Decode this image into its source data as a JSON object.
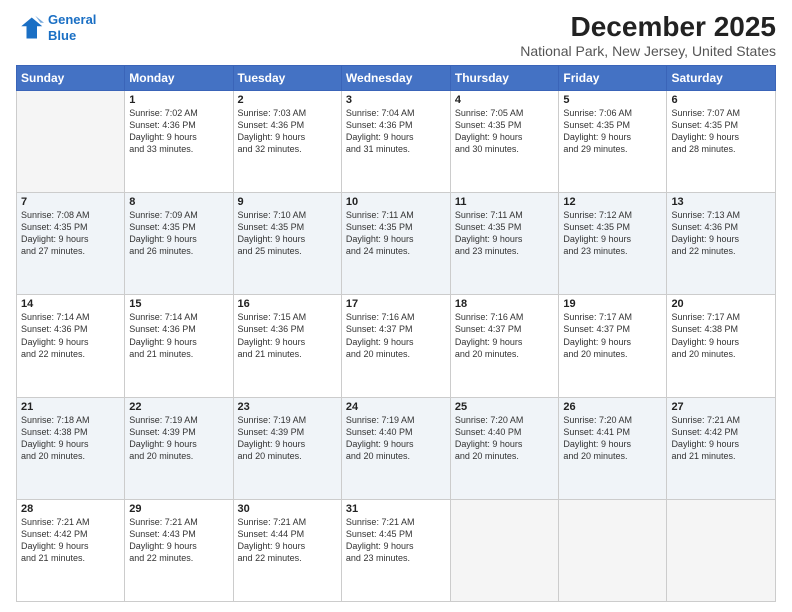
{
  "logo": {
    "line1": "General",
    "line2": "Blue"
  },
  "title": "December 2025",
  "subtitle": "National Park, New Jersey, United States",
  "days_header": [
    "Sunday",
    "Monday",
    "Tuesday",
    "Wednesday",
    "Thursday",
    "Friday",
    "Saturday"
  ],
  "weeks": [
    [
      {
        "num": "",
        "info": ""
      },
      {
        "num": "1",
        "info": "Sunrise: 7:02 AM\nSunset: 4:36 PM\nDaylight: 9 hours\nand 33 minutes."
      },
      {
        "num": "2",
        "info": "Sunrise: 7:03 AM\nSunset: 4:36 PM\nDaylight: 9 hours\nand 32 minutes."
      },
      {
        "num": "3",
        "info": "Sunrise: 7:04 AM\nSunset: 4:36 PM\nDaylight: 9 hours\nand 31 minutes."
      },
      {
        "num": "4",
        "info": "Sunrise: 7:05 AM\nSunset: 4:35 PM\nDaylight: 9 hours\nand 30 minutes."
      },
      {
        "num": "5",
        "info": "Sunrise: 7:06 AM\nSunset: 4:35 PM\nDaylight: 9 hours\nand 29 minutes."
      },
      {
        "num": "6",
        "info": "Sunrise: 7:07 AM\nSunset: 4:35 PM\nDaylight: 9 hours\nand 28 minutes."
      }
    ],
    [
      {
        "num": "7",
        "info": "Sunrise: 7:08 AM\nSunset: 4:35 PM\nDaylight: 9 hours\nand 27 minutes."
      },
      {
        "num": "8",
        "info": "Sunrise: 7:09 AM\nSunset: 4:35 PM\nDaylight: 9 hours\nand 26 minutes."
      },
      {
        "num": "9",
        "info": "Sunrise: 7:10 AM\nSunset: 4:35 PM\nDaylight: 9 hours\nand 25 minutes."
      },
      {
        "num": "10",
        "info": "Sunrise: 7:11 AM\nSunset: 4:35 PM\nDaylight: 9 hours\nand 24 minutes."
      },
      {
        "num": "11",
        "info": "Sunrise: 7:11 AM\nSunset: 4:35 PM\nDaylight: 9 hours\nand 23 minutes."
      },
      {
        "num": "12",
        "info": "Sunrise: 7:12 AM\nSunset: 4:35 PM\nDaylight: 9 hours\nand 23 minutes."
      },
      {
        "num": "13",
        "info": "Sunrise: 7:13 AM\nSunset: 4:36 PM\nDaylight: 9 hours\nand 22 minutes."
      }
    ],
    [
      {
        "num": "14",
        "info": "Sunrise: 7:14 AM\nSunset: 4:36 PM\nDaylight: 9 hours\nand 22 minutes."
      },
      {
        "num": "15",
        "info": "Sunrise: 7:14 AM\nSunset: 4:36 PM\nDaylight: 9 hours\nand 21 minutes."
      },
      {
        "num": "16",
        "info": "Sunrise: 7:15 AM\nSunset: 4:36 PM\nDaylight: 9 hours\nand 21 minutes."
      },
      {
        "num": "17",
        "info": "Sunrise: 7:16 AM\nSunset: 4:37 PM\nDaylight: 9 hours\nand 20 minutes."
      },
      {
        "num": "18",
        "info": "Sunrise: 7:16 AM\nSunset: 4:37 PM\nDaylight: 9 hours\nand 20 minutes."
      },
      {
        "num": "19",
        "info": "Sunrise: 7:17 AM\nSunset: 4:37 PM\nDaylight: 9 hours\nand 20 minutes."
      },
      {
        "num": "20",
        "info": "Sunrise: 7:17 AM\nSunset: 4:38 PM\nDaylight: 9 hours\nand 20 minutes."
      }
    ],
    [
      {
        "num": "21",
        "info": "Sunrise: 7:18 AM\nSunset: 4:38 PM\nDaylight: 9 hours\nand 20 minutes."
      },
      {
        "num": "22",
        "info": "Sunrise: 7:19 AM\nSunset: 4:39 PM\nDaylight: 9 hours\nand 20 minutes."
      },
      {
        "num": "23",
        "info": "Sunrise: 7:19 AM\nSunset: 4:39 PM\nDaylight: 9 hours\nand 20 minutes."
      },
      {
        "num": "24",
        "info": "Sunrise: 7:19 AM\nSunset: 4:40 PM\nDaylight: 9 hours\nand 20 minutes."
      },
      {
        "num": "25",
        "info": "Sunrise: 7:20 AM\nSunset: 4:40 PM\nDaylight: 9 hours\nand 20 minutes."
      },
      {
        "num": "26",
        "info": "Sunrise: 7:20 AM\nSunset: 4:41 PM\nDaylight: 9 hours\nand 20 minutes."
      },
      {
        "num": "27",
        "info": "Sunrise: 7:21 AM\nSunset: 4:42 PM\nDaylight: 9 hours\nand 21 minutes."
      }
    ],
    [
      {
        "num": "28",
        "info": "Sunrise: 7:21 AM\nSunset: 4:42 PM\nDaylight: 9 hours\nand 21 minutes."
      },
      {
        "num": "29",
        "info": "Sunrise: 7:21 AM\nSunset: 4:43 PM\nDaylight: 9 hours\nand 22 minutes."
      },
      {
        "num": "30",
        "info": "Sunrise: 7:21 AM\nSunset: 4:44 PM\nDaylight: 9 hours\nand 22 minutes."
      },
      {
        "num": "31",
        "info": "Sunrise: 7:21 AM\nSunset: 4:45 PM\nDaylight: 9 hours\nand 23 minutes."
      },
      {
        "num": "",
        "info": ""
      },
      {
        "num": "",
        "info": ""
      },
      {
        "num": "",
        "info": ""
      }
    ]
  ]
}
